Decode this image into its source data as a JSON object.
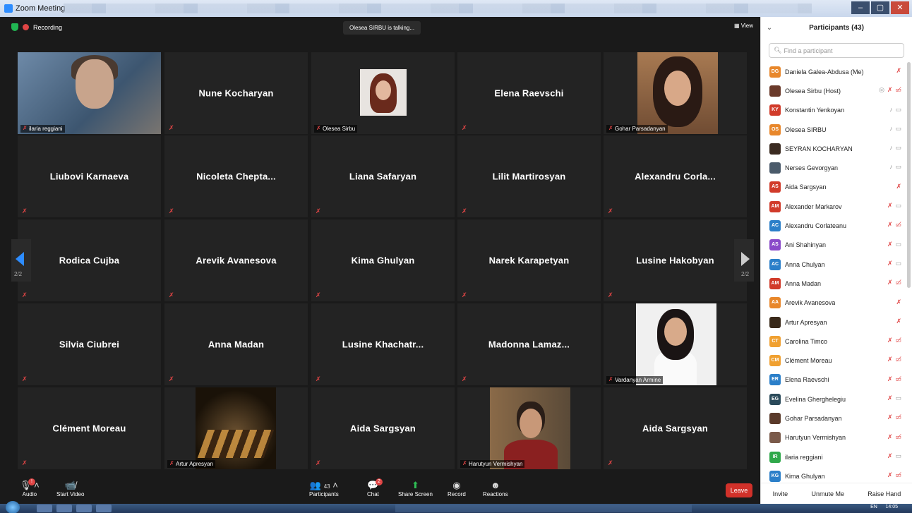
{
  "window": {
    "title": "Zoom Meeting",
    "buttons": [
      "–",
      "▢",
      "✕"
    ]
  },
  "topbar": {
    "recording": "Recording",
    "talking": "Olesea SIRBU is talking...",
    "view": "View"
  },
  "tiles": [
    {
      "label": "ilaria reggiani"
    },
    {
      "name": "Nune Kocharyan"
    },
    {
      "label": "Olesea Sirbu"
    },
    {
      "name": "Elena Raevschi"
    },
    {
      "label": "Gohar Parsadanyan"
    },
    {
      "name": "Liubovi Karnaeva"
    },
    {
      "name": "Nicoleta Chepta..."
    },
    {
      "name": "Liana Safaryan"
    },
    {
      "name": "Lilit Martirosyan"
    },
    {
      "name": "Alexandru Corla..."
    },
    {
      "name": "Rodica Cujba"
    },
    {
      "name": "Arevik Avanesova"
    },
    {
      "name": "Kima Ghulyan"
    },
    {
      "name": "Narek Karapetyan"
    },
    {
      "name": "Lusine Hakobyan"
    },
    {
      "name": "Silvia Ciubrei"
    },
    {
      "name": "Anna Madan"
    },
    {
      "name": "Lusine Khachatr..."
    },
    {
      "name": "Madonna Lamaz..."
    },
    {
      "label": "Vardanyan Armine"
    },
    {
      "name": "Clément Moreau"
    },
    {
      "label": "Artur Apresyan"
    },
    {
      "name": "Aida Sargsyan"
    },
    {
      "label": "Harutyun Vermishyan"
    },
    {
      "name": "Aida Sargsyan"
    }
  ],
  "pager": {
    "left": "2/2",
    "right": "2/2"
  },
  "toolbar": {
    "audio": "Audio",
    "audio_badge": "!",
    "start_video": "Start Video",
    "participants": "Participants",
    "participants_count": "43",
    "chat": "Chat",
    "chat_badge": "2",
    "share_screen": "Share Screen",
    "record": "Record",
    "reactions": "Reactions",
    "leave": "Leave"
  },
  "panel": {
    "title": "Participants (43)",
    "search_placeholder": "Find a participant",
    "participants": [
      {
        "initials": "DG",
        "color": "#e8872b",
        "name": "Daniela Galea-Abdusa (Me)",
        "icons": "mute"
      },
      {
        "initials": "",
        "color": "#6a3a2a",
        "name": "Olesea Sirbu (Host)",
        "icons": "share mute video-off"
      },
      {
        "initials": "KY",
        "color": "#d13b2a",
        "name": "Konstantin Yenkoyan",
        "icons": "mic video"
      },
      {
        "initials": "OS",
        "color": "#e8872b",
        "name": "Olesea SIRBU",
        "icons": "mic video"
      },
      {
        "initials": "",
        "color": "#3a2a20",
        "name": "SEYRAN KOCHARYAN",
        "icons": "mic video"
      },
      {
        "initials": "",
        "color": "#4a5a6a",
        "name": "Nerses Gevorgyan",
        "icons": "mic video"
      },
      {
        "initials": "AS",
        "color": "#d13b2a",
        "name": "Aida Sargsyan",
        "icons": "mute"
      },
      {
        "initials": "AM",
        "color": "#d13b2a",
        "name": "Alexander Markarov",
        "icons": "mute video"
      },
      {
        "initials": "AC",
        "color": "#2b7fc9",
        "name": "Alexandru Corlateanu",
        "icons": "mute video-off"
      },
      {
        "initials": "AS",
        "color": "#8a4ac9",
        "name": "Ani Shahinyan",
        "icons": "mute video"
      },
      {
        "initials": "AC",
        "color": "#2b7fc9",
        "name": "Anna Chulyan",
        "icons": "mute video"
      },
      {
        "initials": "AM",
        "color": "#d13b2a",
        "name": "Anna Madan",
        "icons": "mute video-off"
      },
      {
        "initials": "AA",
        "color": "#e8872b",
        "name": "Arevik Avanesova",
        "icons": "mute"
      },
      {
        "initials": "",
        "color": "#3a2a1a",
        "name": "Artur Apresyan",
        "icons": "mute"
      },
      {
        "initials": "CT",
        "color": "#f0a030",
        "name": "Carolina Timco",
        "icons": "mute video-off"
      },
      {
        "initials": "CM",
        "color": "#f0a030",
        "name": "Clément Moreau",
        "icons": "mute video-off"
      },
      {
        "initials": "ER",
        "color": "#2b7fc9",
        "name": "Elena Raevschi",
        "icons": "mute video-off"
      },
      {
        "initials": "EG",
        "color": "#2a4a5a",
        "name": "Evelina Gherghelegiu",
        "icons": "mute video"
      },
      {
        "initials": "",
        "color": "#5a3a2a",
        "name": "Gohar Parsadanyan",
        "icons": "mute video-off"
      },
      {
        "initials": "",
        "color": "#7a5a4a",
        "name": "Harutyun Vermishyan",
        "icons": "mute video-off"
      },
      {
        "initials": "IR",
        "color": "#2fa84a",
        "name": "ilaria reggiani",
        "icons": "mute video"
      },
      {
        "initials": "KG",
        "color": "#2b7fc9",
        "name": "Kima Ghulyan",
        "icons": "mute video-off"
      }
    ],
    "invite": "Invite",
    "unmute_me": "Unmute Me",
    "raise_hand": "Raise Hand"
  },
  "taskbar": {
    "lang": "EN",
    "time": "14:05"
  }
}
